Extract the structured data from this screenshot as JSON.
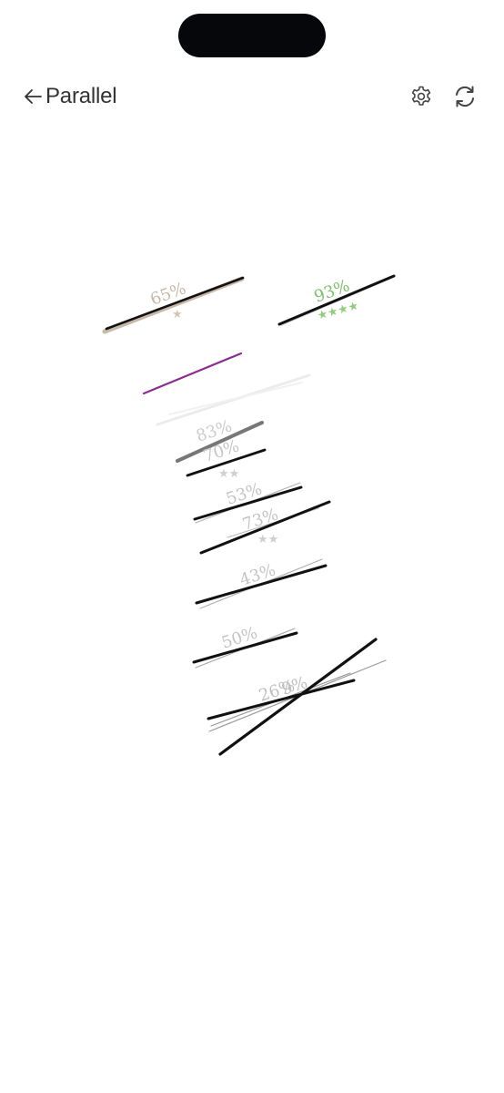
{
  "header": {
    "title": "Parallel"
  },
  "icons": {
    "back": "arrow-left-icon",
    "settings": "gear-icon",
    "refresh": "refresh-icon"
  },
  "colors": {
    "stroke": "#111111",
    "faint": "#bdbdbd",
    "green": "#7cc36a",
    "purple": "#8a2d8e",
    "tan": "#c8b8a8"
  },
  "scores": [
    {
      "percent": "65%",
      "stars": "★"
    },
    {
      "percent": "93%",
      "stars": "★★★★"
    },
    {
      "percent": "83%",
      "stars": ""
    },
    {
      "percent": "70%",
      "stars": "★★"
    },
    {
      "percent": "53%",
      "stars": ""
    },
    {
      "percent": "73%",
      "stars": "★★"
    },
    {
      "percent": "43%",
      "stars": ""
    },
    {
      "percent": "50%",
      "stars": ""
    },
    {
      "percent": "26%",
      "stars": ""
    },
    {
      "percent": "9%",
      "stars": ""
    }
  ]
}
